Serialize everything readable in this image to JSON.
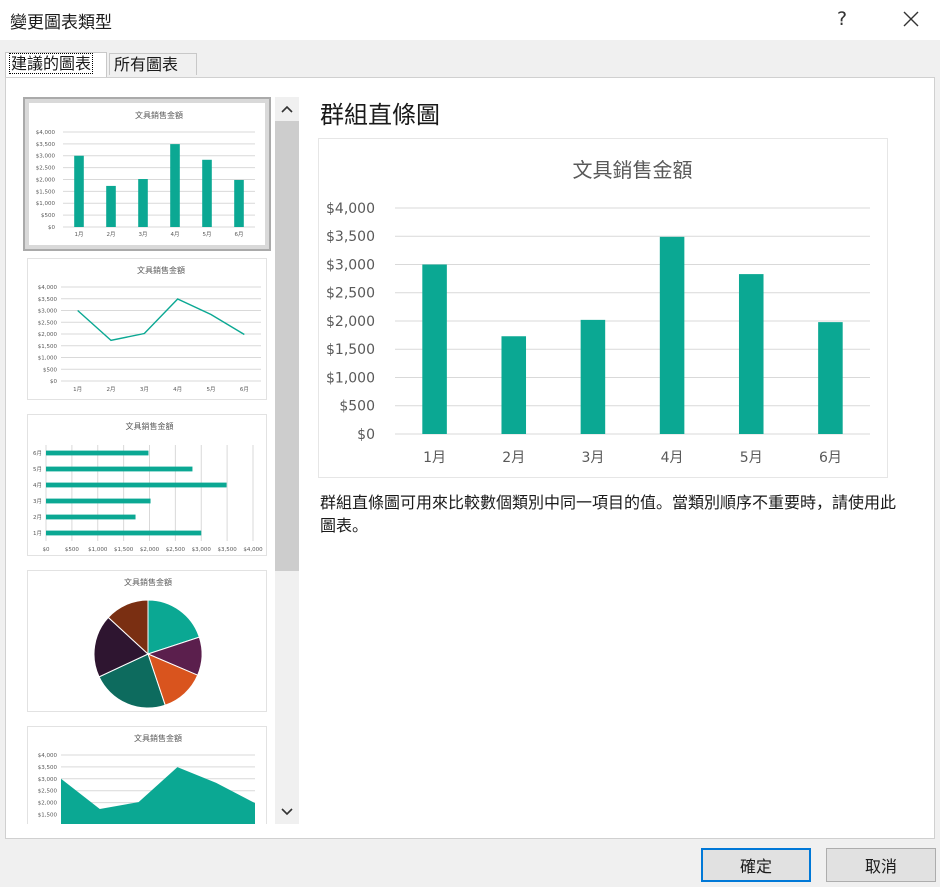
{
  "window": {
    "title": "變更圖表類型",
    "help_label": "?"
  },
  "tabs": [
    {
      "label": "建議的圖表",
      "active": true
    },
    {
      "label": "所有圖表",
      "active": false
    }
  ],
  "chart_data": [
    {
      "type": "bar",
      "title": "文具銷售金額",
      "categories": [
        "1月",
        "2月",
        "3月",
        "4月",
        "5月",
        "6月"
      ],
      "values": [
        3000,
        1730,
        2020,
        3490,
        2830,
        1980
      ],
      "ylim": [
        0,
        4000
      ],
      "yticks": [
        "$0",
        "$500",
        "$1,000",
        "$1,500",
        "$2,000",
        "$2,500",
        "$3,000",
        "$3,500",
        "$4,000"
      ],
      "grid": true,
      "color": "#0ba893"
    },
    {
      "type": "line",
      "title": "文具銷售金額",
      "categories": [
        "1月",
        "2月",
        "3月",
        "4月",
        "5月",
        "6月"
      ],
      "values": [
        3000,
        1730,
        2020,
        3490,
        2830,
        1980
      ],
      "ylim": [
        0,
        4000
      ],
      "yticks": [
        "$0",
        "$500",
        "$1,000",
        "$1,500",
        "$2,000",
        "$2,500",
        "$3,000",
        "$3,500",
        "$4,000"
      ],
      "color": "#0ba893"
    },
    {
      "type": "bar",
      "orientation": "horizontal",
      "title": "文具銷售金額",
      "categories": [
        "1月",
        "2月",
        "3月",
        "4月",
        "5月",
        "6月"
      ],
      "values": [
        3000,
        1730,
        2020,
        3490,
        2830,
        1980
      ],
      "xlim": [
        0,
        4000
      ],
      "xticks": [
        "$0",
        "$500",
        "$1,000",
        "$1,500",
        "$2,000",
        "$2,500",
        "$3,000",
        "$3,500",
        "$4,000"
      ],
      "color": "#0ba893"
    },
    {
      "type": "pie",
      "title": "文具銷售金額",
      "categories": [
        "1月",
        "2月",
        "3月",
        "4月",
        "5月",
        "6月"
      ],
      "values": [
        3000,
        1730,
        2020,
        3490,
        2830,
        1980
      ],
      "colors": [
        "#0ba893",
        "#5b1f4d",
        "#d9541e",
        "#0d6b5e",
        "#2e1530",
        "#7a2f12"
      ]
    },
    {
      "type": "area",
      "title": "文具銷售金額",
      "categories": [
        "1月",
        "2月",
        "3月",
        "4月",
        "5月",
        "6月"
      ],
      "values": [
        3000,
        1730,
        2020,
        3490,
        2830,
        1980
      ],
      "yticks": [
        "$4,000",
        "$3,500",
        "$3,000",
        "$2,500",
        "$2,000",
        "$1,500"
      ],
      "color": "#0ba893"
    }
  ],
  "preview": {
    "title": "群組直條圖",
    "description": "群組直條圖可用來比較數個類別中同一項目的值。當類別順序不重要時，請使用此圖表。"
  },
  "buttons": {
    "ok": "確定",
    "cancel": "取消"
  }
}
